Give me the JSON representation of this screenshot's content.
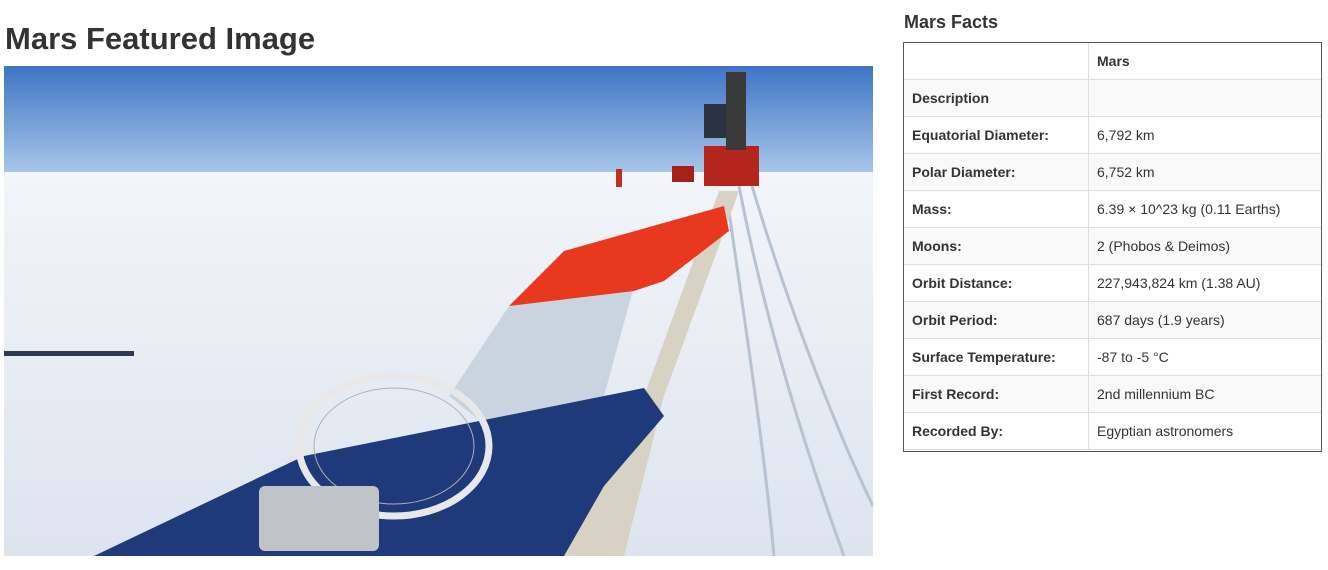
{
  "featured": {
    "title": "Mars Featured Image"
  },
  "facts": {
    "title": "Mars Facts",
    "header": [
      "",
      "Mars"
    ],
    "rows": [
      {
        "label": "Description",
        "value": ""
      },
      {
        "label": "Equatorial Diameter:",
        "value": "6,792 km"
      },
      {
        "label": "Polar Diameter:",
        "value": "6,752 km"
      },
      {
        "label": "Mass:",
        "value": "6.39 × 10^23 kg (0.11 Earths)"
      },
      {
        "label": "Moons:",
        "value": "2 (Phobos & Deimos)"
      },
      {
        "label": "Orbit Distance:",
        "value": "227,943,824 km (1.38 AU)"
      },
      {
        "label": "Orbit Period:",
        "value": "687 days (1.9 years)"
      },
      {
        "label": "Surface Temperature:",
        "value": "-87 to -5 °C"
      },
      {
        "label": "First Record:",
        "value": "2nd millennium BC"
      },
      {
        "label": "Recorded By:",
        "value": "Egyptian astronomers"
      }
    ]
  },
  "colors": {
    "sky": "#5b8fcf",
    "snow": "#e9eef4",
    "balloon_red": "#e8381e",
    "tarp_blue": "#1f3a7a"
  }
}
